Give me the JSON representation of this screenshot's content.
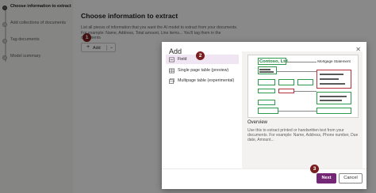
{
  "sidebar": {
    "steps": [
      {
        "label": "Choose information to extract"
      },
      {
        "label": "Add collections of documents"
      },
      {
        "label": "Tag documents"
      },
      {
        "label": "Model summary"
      }
    ]
  },
  "main": {
    "title": "Choose information to extract",
    "description": "List all pieces of information that you want the AI model to extract from your documents. For example: Name, Address, Total amount, Line items... You'll tag them in the documents",
    "add_button": {
      "label": "Add",
      "icon": "plus-icon",
      "dropdown_icon": "chevron-down-icon"
    }
  },
  "badges": [
    "1",
    "2",
    "3"
  ],
  "dialog": {
    "title": "Add",
    "options": [
      {
        "label": "Field",
        "icon": "field-icon"
      },
      {
        "label": "Single page table (preview)",
        "icon": "table-icon"
      },
      {
        "label": "Multipage table (experimental)",
        "icon": "multipage-table-icon"
      }
    ],
    "preview": {
      "brand": "Contoso, Ltd.",
      "doc_title": "Mortgage Statement"
    },
    "overview": {
      "heading": "Overview",
      "text": "Use this to extract printed or handwritten text from your documents. For example: Name, Address, Phone number, Due date, Amount..."
    },
    "buttons": {
      "next": "Next",
      "cancel": "Cancel"
    }
  },
  "colors": {
    "accent": "#742774",
    "badge": "#7a1f1f",
    "selected_option": "#f0e6f3",
    "preview_green": "#2e9a4b",
    "preview_red": "#b5313c"
  }
}
